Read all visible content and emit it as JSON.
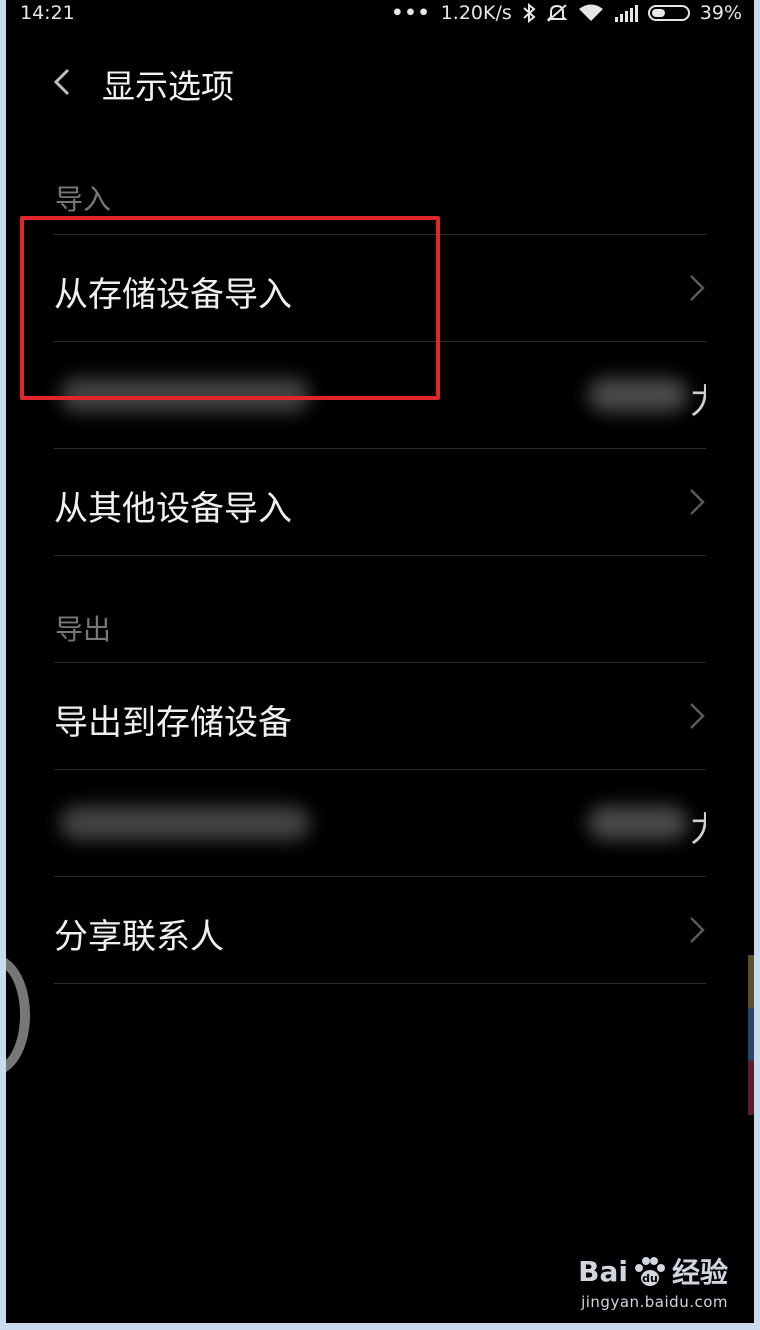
{
  "status_bar": {
    "time": "14:21",
    "dots": "•••",
    "net_speed": "1.20K/s",
    "battery_percent": "39%",
    "battery_level": 0.39,
    "icons": [
      "bluetooth-icon",
      "mute-icon",
      "wifi-icon",
      "signal-icon",
      "battery-icon"
    ]
  },
  "header": {
    "back_icon": "chevron-left-icon",
    "title": "显示选项"
  },
  "sections": [
    {
      "label": "导入",
      "items": [
        {
          "label": "从存储设备导入",
          "blurred": false
        },
        {
          "label": "",
          "blurred": true,
          "partial_right_text": "力"
        },
        {
          "label": "从其他设备导入",
          "blurred": false
        }
      ]
    },
    {
      "label": "导出",
      "items": [
        {
          "label": "导出到存储设备",
          "blurred": false
        },
        {
          "label": "",
          "blurred": true,
          "partial_right_text": "力"
        },
        {
          "label": "分享联系人",
          "blurred": false
        }
      ]
    }
  ],
  "annotation": {
    "highlight_color": "#e0262b"
  },
  "watermark": {
    "brand_left": "Bai",
    "brand_mid": "du",
    "brand_right": "经验",
    "url": "jingyan.baidu.com"
  },
  "colors": {
    "background": "#000000",
    "text_primary": "#f0f0f0",
    "text_section": "#777777",
    "divider": "#2a2a2a"
  }
}
